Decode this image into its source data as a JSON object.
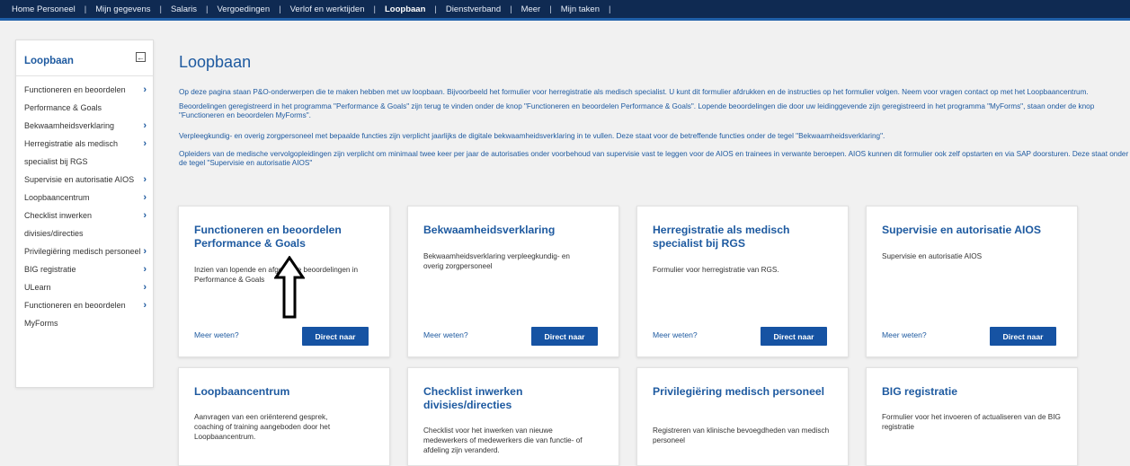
{
  "topnav": {
    "items": [
      {
        "label": "Home Personeel"
      },
      {
        "label": "Mijn gegevens"
      },
      {
        "label": "Salaris"
      },
      {
        "label": "Vergoedingen"
      },
      {
        "label": "Verlof en werktijden"
      },
      {
        "label": "Loopbaan",
        "active": true
      },
      {
        "label": "Dienstverband"
      },
      {
        "label": "Meer"
      },
      {
        "label": "Mijn taken"
      }
    ]
  },
  "sidebar": {
    "title": "Loopbaan",
    "items": [
      {
        "label": "Functioneren en beoordelen Performance & Goals",
        "chevron": true
      },
      {
        "label": "Bekwaamheidsverklaring",
        "chevron": true
      },
      {
        "label": "Herregistratie als medisch specialist bij RGS",
        "chevron": true
      },
      {
        "label": "Supervisie en autorisatie AIOS",
        "chevron": true
      },
      {
        "label": "Loopbaancentrum",
        "chevron": true
      },
      {
        "label": "Checklist inwerken divisies/directies",
        "chevron": true
      },
      {
        "label": "Privilegiëring medisch personeel",
        "chevron": true
      },
      {
        "label": "BIG registratie",
        "chevron": true
      },
      {
        "label": "ULearn",
        "chevron": true
      },
      {
        "label": "Functioneren en beoordelen MyForms",
        "chevron": true
      }
    ]
  },
  "main": {
    "title": "Loopbaan",
    "intro": [
      "Op deze pagina staan P&O-onderwerpen die te maken hebben met uw loopbaan. Bijvoorbeeld het formulier voor herregistratie als medisch specialist. U kunt dit formulier afdrukken en de instructies op het formulier volgen. Neem voor vragen contact op met het Loopbaancentrum.",
      "Beoordelingen geregistreerd in het programma \"Performance & Goals\" zijn terug te vinden onder de knop \"Functioneren en beoordelen Performance & Goals\". Lopende beoordelingen die door uw leidinggevende zijn geregistreerd in het programma \"MyForms\", staan onder de knop \"Functioneren en beoordelen MyForms\".",
      "Verpleegkundig- en overig zorgpersoneel met bepaalde functies zijn verplicht jaarlijks de digitale bekwaamheidsverklaring in te vullen. Deze staat voor de betreffende functies onder de tegel \"Bekwaamheidsverklaring\".",
      "Opleiders van de medische vervolgopleidingen zijn verplicht om minimaal twee keer per jaar de autorisaties onder voorbehoud van supervisie vast te leggen voor de AIOS en trainees in verwante beroepen. AIOS kunnen dit formulier ook zelf opstarten en via SAP doorsturen. Deze staat onder de tegel \"Supervisie en autorisatie AIOS\""
    ]
  },
  "cards": [
    {
      "title": "Functioneren en beoordelen Performance & Goals",
      "desc": "Inzien van lopende en afgeronde beoordelingen in Performance & Goals",
      "more": "Meer weten?",
      "button": "Direct naar"
    },
    {
      "title": "Bekwaamheidsverklaring",
      "desc": "Bekwaamheidsverklaring verpleegkundig- en overig zorgpersoneel",
      "more": "Meer weten?",
      "button": "Direct naar"
    },
    {
      "title": "Herregistratie als medisch specialist bij RGS",
      "desc": "Formulier voor herregistratie van RGS.",
      "more": "Meer weten?",
      "button": "Direct naar"
    },
    {
      "title": "Supervisie en autorisatie AIOS",
      "desc": "Supervisie en autorisatie AIOS",
      "more": "Meer weten?",
      "button": "Direct naar"
    },
    {
      "title": "Loopbaancentrum",
      "desc": "Aanvragen van een oriënterend gesprek, coaching of training aangeboden door het Loopbaancentrum."
    },
    {
      "title": "Checklist inwerken divisies/directies",
      "desc": "Checklist voor het inwerken van nieuwe medewerkers of medewerkers die van functie- of afdeling zijn veranderd."
    },
    {
      "title": "Privilegiëring medisch personeel",
      "desc": "Registreren van klinische bevoegdheden van medisch personeel"
    },
    {
      "title": "BIG registratie",
      "desc": "Formulier voor het invoeren of actualiseren van de BIG registratie"
    }
  ],
  "icons": {
    "collapse": "arrow-left-box-icon",
    "chevron": "chevron-right-icon",
    "annotation": "up-arrow-outline-icon"
  },
  "colors": {
    "nav_bg": "#0f2a52",
    "accent": "#1e5aa0",
    "button": "#1653a3"
  }
}
